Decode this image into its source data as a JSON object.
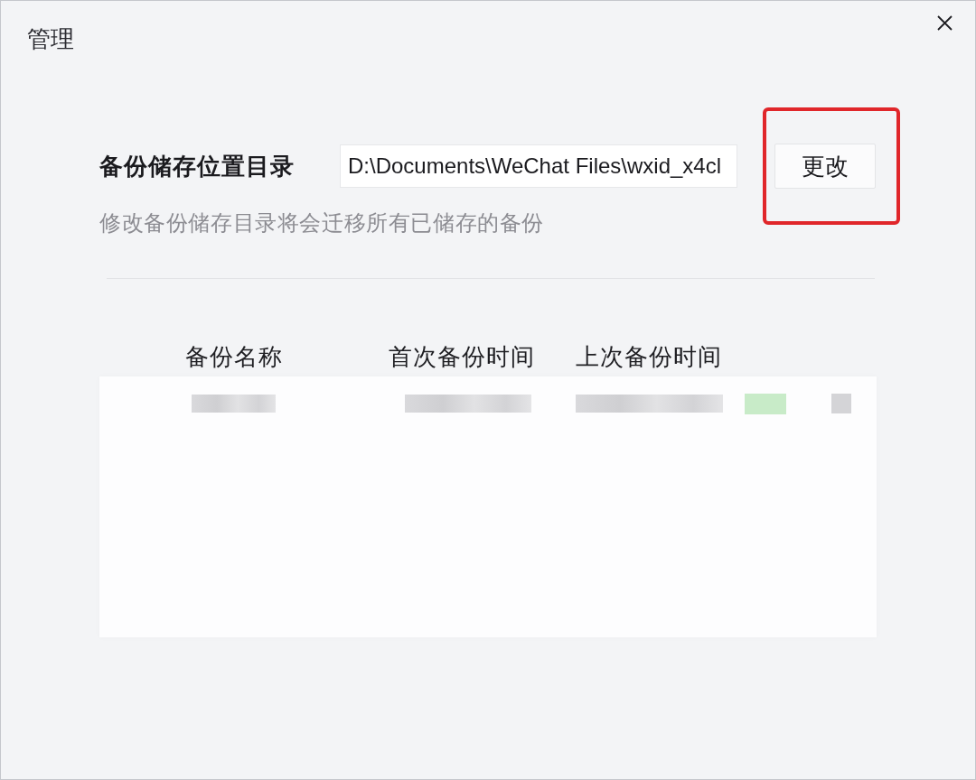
{
  "window": {
    "title": "管理"
  },
  "storage": {
    "label": "备份储存位置目录",
    "path": "D:\\Documents\\WeChat Files\\wxid_x4cl",
    "button": {
      "label": "更改",
      "highlighted": true
    },
    "hint": "修改备份储存目录将会迁移所有已储存的备份"
  },
  "table": {
    "columns": [
      "备份名称",
      "首次备份时间",
      "上次备份时间"
    ],
    "rows": [
      {
        "cells": [
          {
            "kind": "blurred_text"
          },
          {
            "kind": "blurred_text"
          },
          {
            "kind": "blurred_text"
          },
          {
            "kind": "blurred_mark",
            "color": "#c8ebc8"
          },
          {
            "kind": "blurred_mark",
            "color": "#d4d4d7"
          }
        ]
      }
    ]
  }
}
